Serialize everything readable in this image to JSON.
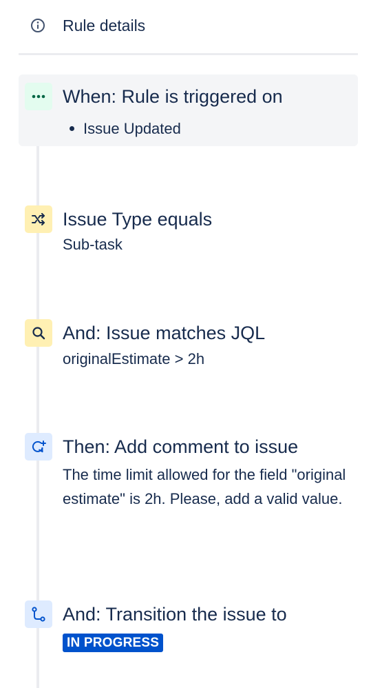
{
  "header": {
    "icon": "info-icon",
    "label": "Rule details"
  },
  "steps": [
    {
      "icon": "more-dots-icon",
      "title": "When: Rule is triggered on",
      "bullets": [
        "Issue Updated"
      ]
    },
    {
      "icon": "branch-shuffle-icon",
      "title": "Issue Type equals",
      "subtitle": "Sub-task"
    },
    {
      "icon": "search-icon",
      "title": "And: Issue matches JQL",
      "subtitle": "originalEstimate > 2h"
    },
    {
      "icon": "comment-add-icon",
      "title": "Then: Add comment to issue",
      "subtitle": "The time limit allowed for the field \"original estimate\" is 2h. Please, add a valid value."
    },
    {
      "icon": "transition-icon",
      "title": "And: Transition the issue to",
      "status": "IN PROGRESS"
    }
  ],
  "colors": {
    "text": "#172b4d",
    "trigger_icon_bg": "#e3fcef",
    "condition_icon_bg": "#fff0b3",
    "action_icon_bg": "#deebff",
    "status_bg": "#0052cc"
  }
}
